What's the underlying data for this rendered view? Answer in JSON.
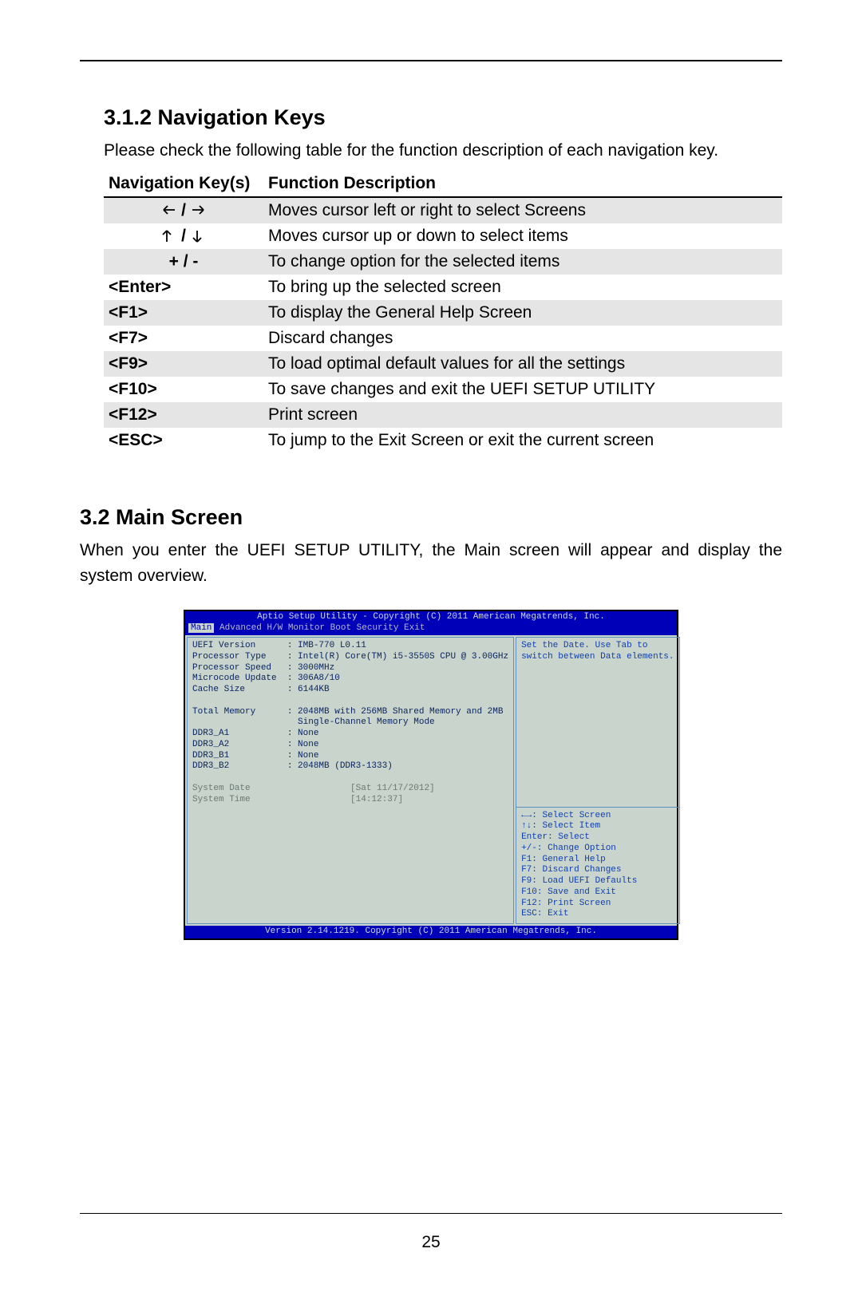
{
  "page_number": "25",
  "section1": {
    "heading": "3.1.2  Navigation Keys",
    "intro": "Please check the following table for the function description of each navigation key.",
    "th_key": "Navigation Key(s)",
    "th_desc": "Function Description",
    "rows": [
      {
        "key_type": "arrows_lr",
        "key": "",
        "desc": "Moves cursor left or right to select Screens",
        "shade": true
      },
      {
        "key_type": "arrows_ud",
        "key": "",
        "desc": "Moves cursor up or down to select items",
        "shade": false
      },
      {
        "key_type": "text",
        "key": "+  /  -",
        "desc": "To change option for the selected items",
        "shade": true
      },
      {
        "key_type": "text",
        "key": "<Enter>",
        "desc": "To bring up the selected screen",
        "shade": false
      },
      {
        "key_type": "text",
        "key": "<F1>",
        "desc": "To display the General Help Screen",
        "shade": true
      },
      {
        "key_type": "text",
        "key": "<F7>",
        "desc": "Discard changes",
        "shade": false
      },
      {
        "key_type": "text",
        "key": "<F9>",
        "desc": "To load optimal default values for all the settings",
        "shade": true
      },
      {
        "key_type": "text",
        "key": "<F10>",
        "desc": "To save changes and exit the UEFI SETUP UTILITY",
        "shade": false
      },
      {
        "key_type": "text",
        "key": "<F12>",
        "desc": "Print screen",
        "shade": true
      },
      {
        "key_type": "text",
        "key": "<ESC>",
        "desc": "To jump to the Exit Screen or exit the current screen",
        "shade": false
      }
    ]
  },
  "section2": {
    "heading": "3.2  Main Screen",
    "intro": "When you enter the UEFI SETUP UTILITY, the Main screen will appear and display the system overview."
  },
  "bios": {
    "title": "Aptio Setup Utility - Copyright (C) 2011 American Megatrends, Inc.",
    "menu_active": "Main",
    "menu_rest": "Advanced  H/W Monitor  Boot  Security  Exit",
    "left_lines": [
      "UEFI Version      : IMB-770 L0.11",
      "Processor Type    : Intel(R) Core(TM) i5-3550S CPU @ 3.00GHz",
      "Processor Speed   : 3000MHz",
      "Microcode Update  : 306A8/10",
      "Cache Size        : 6144KB",
      "",
      "Total Memory      : 2048MB with 256MB Shared Memory and 2MB",
      "                    Single-Channel Memory Mode",
      "DDR3_A1           : None",
      "DDR3_A2           : None",
      "DDR3_B1           : None",
      "DDR3_B2           : 2048MB (DDR3-1333)"
    ],
    "left_date_label": "System Date",
    "left_date_value": "[Sat 11/17/2012]",
    "left_time_label": "System Time",
    "left_time_value": "[14:12:37]",
    "help_top1": "Set the Date. Use Tab to",
    "help_top2": "switch between Data elements.",
    "help_lines": [
      "←→: Select Screen",
      "↑↓: Select Item",
      "Enter: Select",
      "+/-: Change Option",
      "F1: General Help",
      "F7: Discard Changes",
      "F9: Load UEFI Defaults",
      "F10: Save and Exit",
      "F12: Print Screen",
      "ESC: Exit"
    ],
    "version": "Version 2.14.1219. Copyright (C) 2011 American Megatrends, Inc."
  }
}
